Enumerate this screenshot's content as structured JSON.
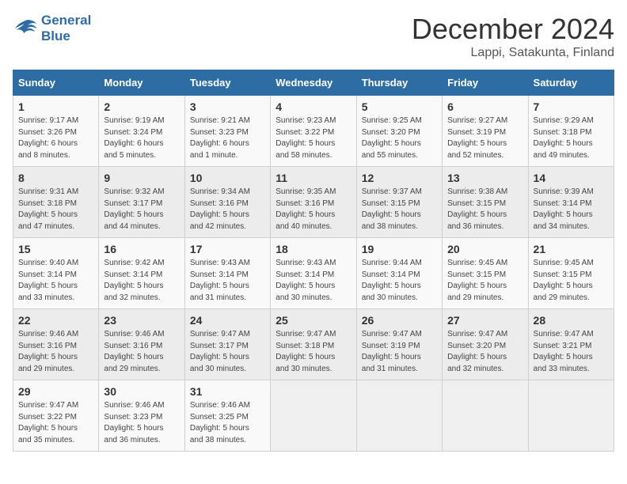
{
  "logo": {
    "line1": "General",
    "line2": "Blue"
  },
  "title": "December 2024",
  "subtitle": "Lappi, Satakunta, Finland",
  "headers": [
    "Sunday",
    "Monday",
    "Tuesday",
    "Wednesday",
    "Thursday",
    "Friday",
    "Saturday"
  ],
  "weeks": [
    [
      {
        "day": "1",
        "detail": "Sunrise: 9:17 AM\nSunset: 3:26 PM\nDaylight: 6 hours\nand 8 minutes."
      },
      {
        "day": "2",
        "detail": "Sunrise: 9:19 AM\nSunset: 3:24 PM\nDaylight: 6 hours\nand 5 minutes."
      },
      {
        "day": "3",
        "detail": "Sunrise: 9:21 AM\nSunset: 3:23 PM\nDaylight: 6 hours\nand 1 minute."
      },
      {
        "day": "4",
        "detail": "Sunrise: 9:23 AM\nSunset: 3:22 PM\nDaylight: 5 hours\nand 58 minutes."
      },
      {
        "day": "5",
        "detail": "Sunrise: 9:25 AM\nSunset: 3:20 PM\nDaylight: 5 hours\nand 55 minutes."
      },
      {
        "day": "6",
        "detail": "Sunrise: 9:27 AM\nSunset: 3:19 PM\nDaylight: 5 hours\nand 52 minutes."
      },
      {
        "day": "7",
        "detail": "Sunrise: 9:29 AM\nSunset: 3:18 PM\nDaylight: 5 hours\nand 49 minutes."
      }
    ],
    [
      {
        "day": "8",
        "detail": "Sunrise: 9:31 AM\nSunset: 3:18 PM\nDaylight: 5 hours\nand 47 minutes."
      },
      {
        "day": "9",
        "detail": "Sunrise: 9:32 AM\nSunset: 3:17 PM\nDaylight: 5 hours\nand 44 minutes."
      },
      {
        "day": "10",
        "detail": "Sunrise: 9:34 AM\nSunset: 3:16 PM\nDaylight: 5 hours\nand 42 minutes."
      },
      {
        "day": "11",
        "detail": "Sunrise: 9:35 AM\nSunset: 3:16 PM\nDaylight: 5 hours\nand 40 minutes."
      },
      {
        "day": "12",
        "detail": "Sunrise: 9:37 AM\nSunset: 3:15 PM\nDaylight: 5 hours\nand 38 minutes."
      },
      {
        "day": "13",
        "detail": "Sunrise: 9:38 AM\nSunset: 3:15 PM\nDaylight: 5 hours\nand 36 minutes."
      },
      {
        "day": "14",
        "detail": "Sunrise: 9:39 AM\nSunset: 3:14 PM\nDaylight: 5 hours\nand 34 minutes."
      }
    ],
    [
      {
        "day": "15",
        "detail": "Sunrise: 9:40 AM\nSunset: 3:14 PM\nDaylight: 5 hours\nand 33 minutes."
      },
      {
        "day": "16",
        "detail": "Sunrise: 9:42 AM\nSunset: 3:14 PM\nDaylight: 5 hours\nand 32 minutes."
      },
      {
        "day": "17",
        "detail": "Sunrise: 9:43 AM\nSunset: 3:14 PM\nDaylight: 5 hours\nand 31 minutes."
      },
      {
        "day": "18",
        "detail": "Sunrise: 9:43 AM\nSunset: 3:14 PM\nDaylight: 5 hours\nand 30 minutes."
      },
      {
        "day": "19",
        "detail": "Sunrise: 9:44 AM\nSunset: 3:14 PM\nDaylight: 5 hours\nand 30 minutes."
      },
      {
        "day": "20",
        "detail": "Sunrise: 9:45 AM\nSunset: 3:15 PM\nDaylight: 5 hours\nand 29 minutes."
      },
      {
        "day": "21",
        "detail": "Sunrise: 9:45 AM\nSunset: 3:15 PM\nDaylight: 5 hours\nand 29 minutes."
      }
    ],
    [
      {
        "day": "22",
        "detail": "Sunrise: 9:46 AM\nSunset: 3:16 PM\nDaylight: 5 hours\nand 29 minutes."
      },
      {
        "day": "23",
        "detail": "Sunrise: 9:46 AM\nSunset: 3:16 PM\nDaylight: 5 hours\nand 29 minutes."
      },
      {
        "day": "24",
        "detail": "Sunrise: 9:47 AM\nSunset: 3:17 PM\nDaylight: 5 hours\nand 30 minutes."
      },
      {
        "day": "25",
        "detail": "Sunrise: 9:47 AM\nSunset: 3:18 PM\nDaylight: 5 hours\nand 30 minutes."
      },
      {
        "day": "26",
        "detail": "Sunrise: 9:47 AM\nSunset: 3:19 PM\nDaylight: 5 hours\nand 31 minutes."
      },
      {
        "day": "27",
        "detail": "Sunrise: 9:47 AM\nSunset: 3:20 PM\nDaylight: 5 hours\nand 32 minutes."
      },
      {
        "day": "28",
        "detail": "Sunrise: 9:47 AM\nSunset: 3:21 PM\nDaylight: 5 hours\nand 33 minutes."
      }
    ],
    [
      {
        "day": "29",
        "detail": "Sunrise: 9:47 AM\nSunset: 3:22 PM\nDaylight: 5 hours\nand 35 minutes."
      },
      {
        "day": "30",
        "detail": "Sunrise: 9:46 AM\nSunset: 3:23 PM\nDaylight: 5 hours\nand 36 minutes."
      },
      {
        "day": "31",
        "detail": "Sunrise: 9:46 AM\nSunset: 3:25 PM\nDaylight: 5 hours\nand 38 minutes."
      },
      {
        "day": "",
        "detail": ""
      },
      {
        "day": "",
        "detail": ""
      },
      {
        "day": "",
        "detail": ""
      },
      {
        "day": "",
        "detail": ""
      }
    ]
  ]
}
